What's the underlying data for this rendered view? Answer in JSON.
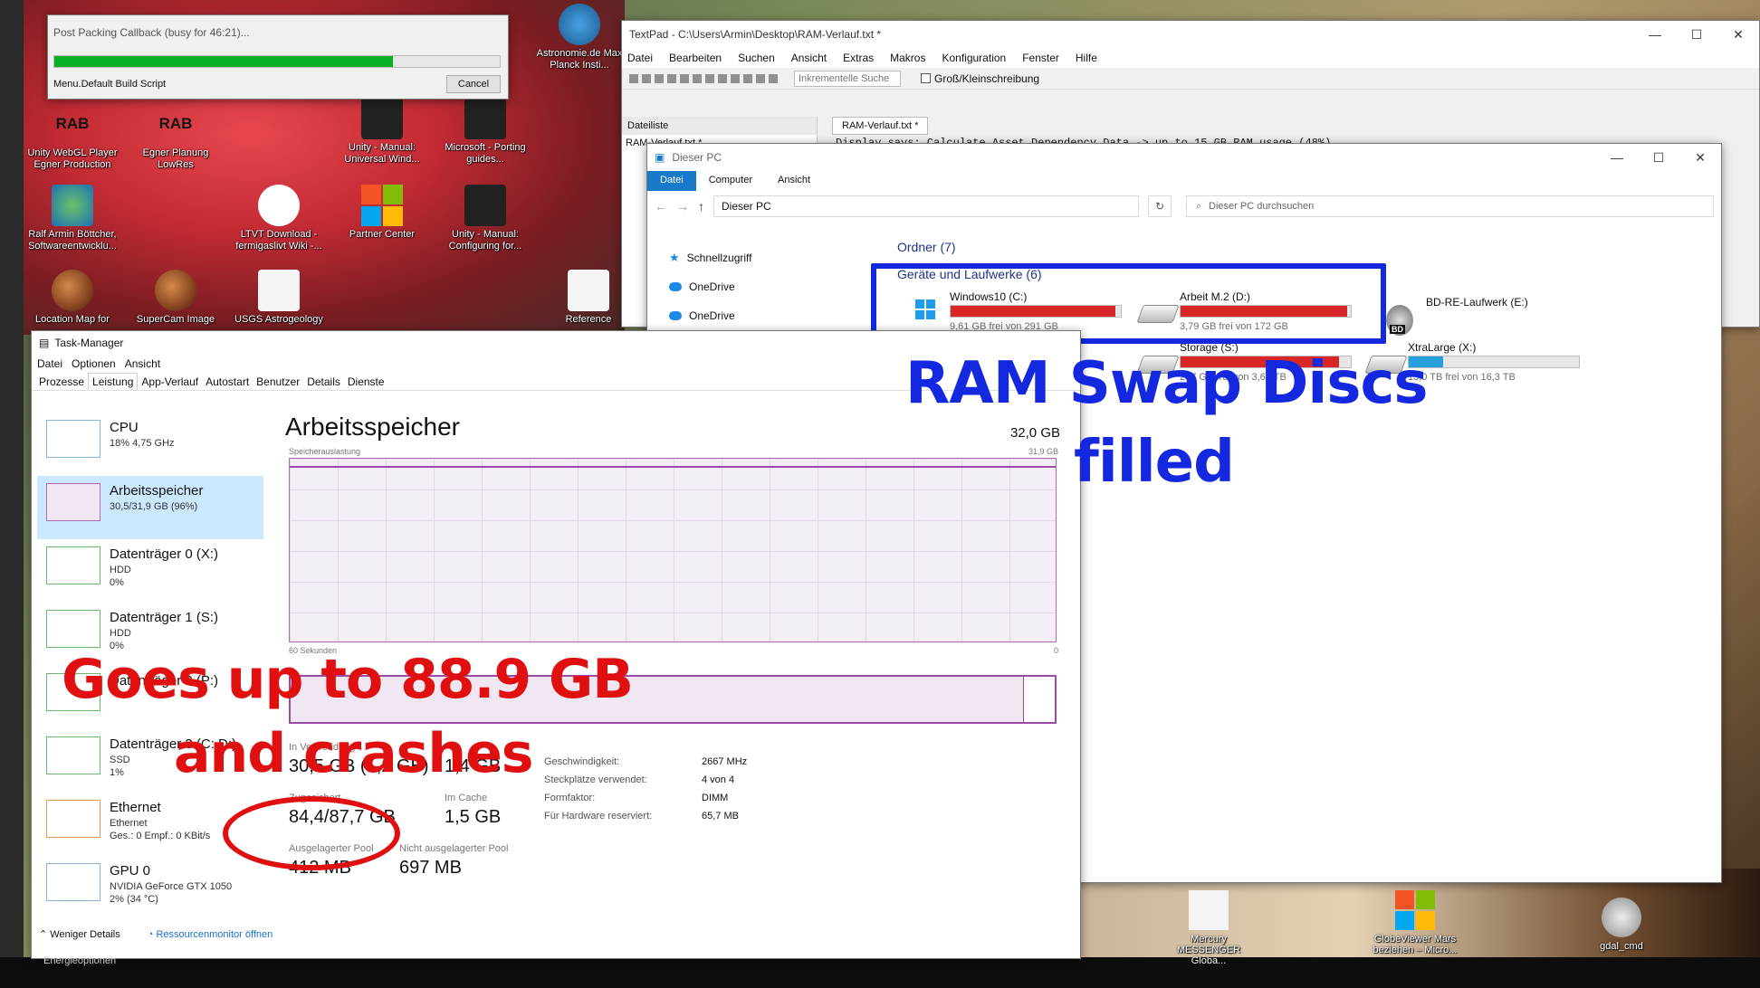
{
  "desktop": {
    "icons_top": [
      {
        "label": "Unity WebGL Player Egner Production",
        "badge": "RAB"
      },
      {
        "label": "Egner Planung LowRes",
        "badge": "RAB"
      },
      {
        "label": "Unity - Manual: Universal Wind..."
      },
      {
        "label": "Microsoft - Porting guides..."
      },
      {
        "label": "Astronomie.de Max Planck Insti..."
      },
      {
        "label": "Ralf Armin Böttcher, Softwareentwicklu..."
      },
      {
        "label": "LTVT Download - fermigaslivt Wiki -..."
      },
      {
        "label": "Partner Center"
      },
      {
        "label": "Unity - Manual: Configuring for..."
      },
      {
        "label": "Location Map for"
      },
      {
        "label": "SuperCam Image"
      },
      {
        "label": "USGS Astrogeology"
      },
      {
        "label": "Reference"
      }
    ],
    "icons_bottom": [
      {
        "label": "Mercury MESSENGER Globa..."
      },
      {
        "label": "GlobeViewer Mars beziehen – Micro..."
      },
      {
        "label": "gdal_cmd"
      }
    ]
  },
  "progress_dialog": {
    "title": "Post Packing Callback (busy for 46:21)...",
    "step": "Menu.Default Build Script",
    "cancel": "Cancel",
    "progress": 0.76
  },
  "textpad": {
    "title": "TextPad - C:\\Users\\Armin\\Desktop\\RAM-Verlauf.txt *",
    "menu": [
      "Datei",
      "Bearbeiten",
      "Suchen",
      "Ansicht",
      "Extras",
      "Makros",
      "Konfiguration",
      "Fenster",
      "Hilfe"
    ],
    "search_placeholder": "Inkrementelle Suche",
    "case_label": "Groß/Kleinschreibung",
    "filelist_header": "Dateiliste",
    "filelist_item": "RAM-Verlauf.txt *",
    "doc_tab": "RAM-Verlauf.txt *",
    "content": "Display says: Calculate Asset Dependency Data -> up to 15 GB RAM usage (48%)"
  },
  "explorer": {
    "title": "Dieser PC",
    "ribbon_tabs": [
      "Datei",
      "Computer",
      "Ansicht"
    ],
    "address": "Dieser PC",
    "search_placeholder": "Dieser PC durchsuchen",
    "nav": [
      "Schnellzugriff",
      "OneDrive",
      "OneDrive"
    ],
    "group_folders": "Ordner (7)",
    "group_drives": "Geräte und Laufwerke (6)",
    "drives": [
      {
        "name": "Windows10 (C:)",
        "free": "9,61 GB frei von 291 GB",
        "used": 0.967,
        "color": "#da2626"
      },
      {
        "name": "Arbeit M.2 (D:)",
        "free": "3,79 GB frei von 172 GB",
        "used": 0.978,
        "color": "#da2626"
      },
      {
        "name": "BD-RE-Laufwerk (E:)",
        "free": "",
        "used": 0,
        "color": "#da2626"
      },
      {
        "name": "Storage (S:)",
        "free": "277 GB frei von 3,63 TB",
        "used": 0.93,
        "color": "#da2626"
      },
      {
        "name": "XtraLarge (X:)",
        "free": "13,0 TB frei von 16,3 TB",
        "used": 0.2,
        "color": "#26a0da"
      }
    ]
  },
  "taskman": {
    "title": "Task-Manager",
    "menu": [
      "Datei",
      "Optionen",
      "Ansicht"
    ],
    "tabs": [
      "Prozesse",
      "Leistung",
      "App-Verlauf",
      "Autostart",
      "Benutzer",
      "Details",
      "Dienste"
    ],
    "side": [
      {
        "title": "CPU",
        "sub1": "18% 4,75 GHz",
        "sub2": ""
      },
      {
        "title": "Arbeitsspeicher",
        "sub1": "30,5/31,9 GB (96%)",
        "sub2": ""
      },
      {
        "title": "Datenträger 0 (X:)",
        "sub1": "HDD",
        "sub2": "0%"
      },
      {
        "title": "Datenträger 1 (S:)",
        "sub1": "HDD",
        "sub2": "0%"
      },
      {
        "title": "Datenträger 2 (P:)",
        "sub1": "",
        "sub2": ""
      },
      {
        "title": "Datenträger 3 (C: D:)",
        "sub1": "SSD",
        "sub2": "1%"
      },
      {
        "title": "Ethernet",
        "sub1": "Ethernet",
        "sub2": "Ges.: 0 Empf.: 0 KBit/s"
      },
      {
        "title": "GPU 0",
        "sub1": "NVIDIA GeForce GTX 1050",
        "sub2": "2% (34 °C)"
      }
    ],
    "main_title": "Arbeitsspeicher",
    "main_total": "32,0 GB",
    "usage_label": "Speicherauslastung",
    "usage_max": "31,9 GB",
    "time_label": "60 Sekunden",
    "time_zero": "0",
    "in_use_label": "In Verwendung",
    "in_use_val": "30,5 GB (1,2 GB)",
    "available_val": "1,4 GB",
    "committed_label": "Zugesichert",
    "committed_val": "84,4/87,7 GB",
    "cached_label": "Im Cache",
    "cached_val": "1,5 GB",
    "paged_label": "Ausgelagerter Pool",
    "paged_val": "412 MB",
    "nonpaged_label": "Nicht ausgelagerter Pool",
    "nonpaged_val": "697 MB",
    "specs": [
      {
        "label": "Geschwindigkeit:",
        "value": "2667 MHz"
      },
      {
        "label": "Steckplätze verwendet:",
        "value": "4 von 4"
      },
      {
        "label": "Formfaktor:",
        "value": "DIMM"
      },
      {
        "label": "Für Hardware reserviert:",
        "value": "65,7 MB"
      }
    ],
    "composition_fill": 0.96,
    "footer_less": "Weniger Details",
    "footer_monitor": "Ressourcenmonitor öffnen",
    "behind_item": "Energieoptionen"
  },
  "annotations": {
    "ram_swap": "RAM Swap Discs",
    "filled": "filled",
    "goes_up": "Goes up to 88.9 GB",
    "crashes": "and crashes"
  }
}
